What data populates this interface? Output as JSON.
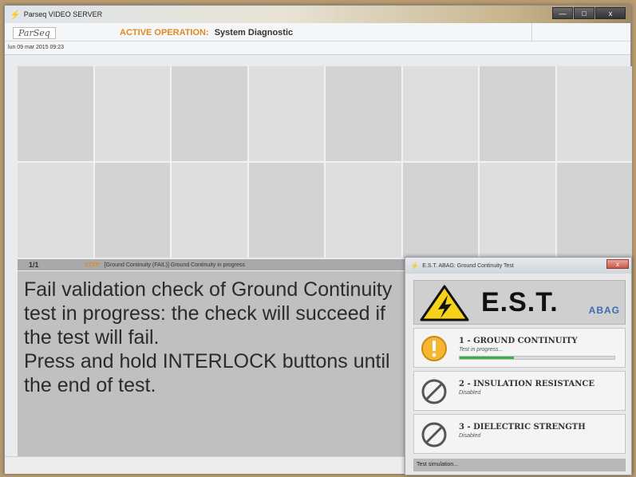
{
  "window": {
    "title": "Parseq VIDEO SERVER",
    "controls": [
      "—",
      "□",
      "x"
    ]
  },
  "header": {
    "logo": "ParSeq",
    "active_operation_label": "ACTIVE OPERATION:",
    "active_operation_value": "System Diagnostic",
    "datetime": "lun 09 mar 2015  09:23"
  },
  "step": {
    "counter": "1/1",
    "label": "STEP:",
    "text": "[Ground Continuity (FAIL)] Ground Continuity in progress"
  },
  "message": "Fail validation check of Ground Continuity test in progress: the check will succeed if the test will fail.\nPress and hold INTERLOCK buttons until the end of test.",
  "popup": {
    "title": "E.S.T. ABAG: Ground Continuity Test",
    "close": "x",
    "banner_title": "E.S.T.",
    "banner_brand": "ABAG",
    "tests": [
      {
        "name": "1 - GROUND CONTINUITY",
        "status": "Test in progress...",
        "icon": "warning-circle-icon",
        "progress": 0.35
      },
      {
        "name": "2 - INSULATION RESISTANCE",
        "status": "Disabled",
        "icon": "disabled-icon"
      },
      {
        "name": "3 - DIELECTRIC STRENGTH",
        "status": "Disabled",
        "icon": "disabled-icon"
      }
    ],
    "status_bar": "Test simulation..."
  },
  "colors": {
    "accent_orange": "#e08a20",
    "progress_green": "#39b14a",
    "abag_blue": "#3b6bb3"
  }
}
